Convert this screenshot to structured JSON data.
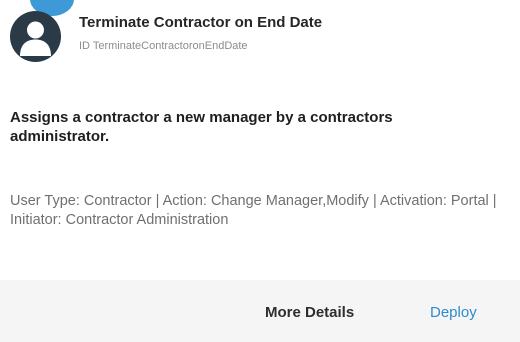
{
  "card": {
    "title": "Terminate Contractor on End Date",
    "id_text": "ID TerminateContractoronEndDate",
    "description": "Assigns a contractor a new manager by a contractors administrator.",
    "meta": "User Type: Contractor | Action: Change Manager,Modify | Activation: Portal | Initiator: Contractor Administration",
    "avatar_icon": "user-silhouette-icon"
  },
  "actions": {
    "more_details_label": "More Details",
    "deploy_label": "Deploy"
  },
  "colors": {
    "accent": "#3d9ad6",
    "avatar_bg": "#2b3a47",
    "link": "#2d8bd0",
    "footer_bg": "#f5f5f5"
  }
}
